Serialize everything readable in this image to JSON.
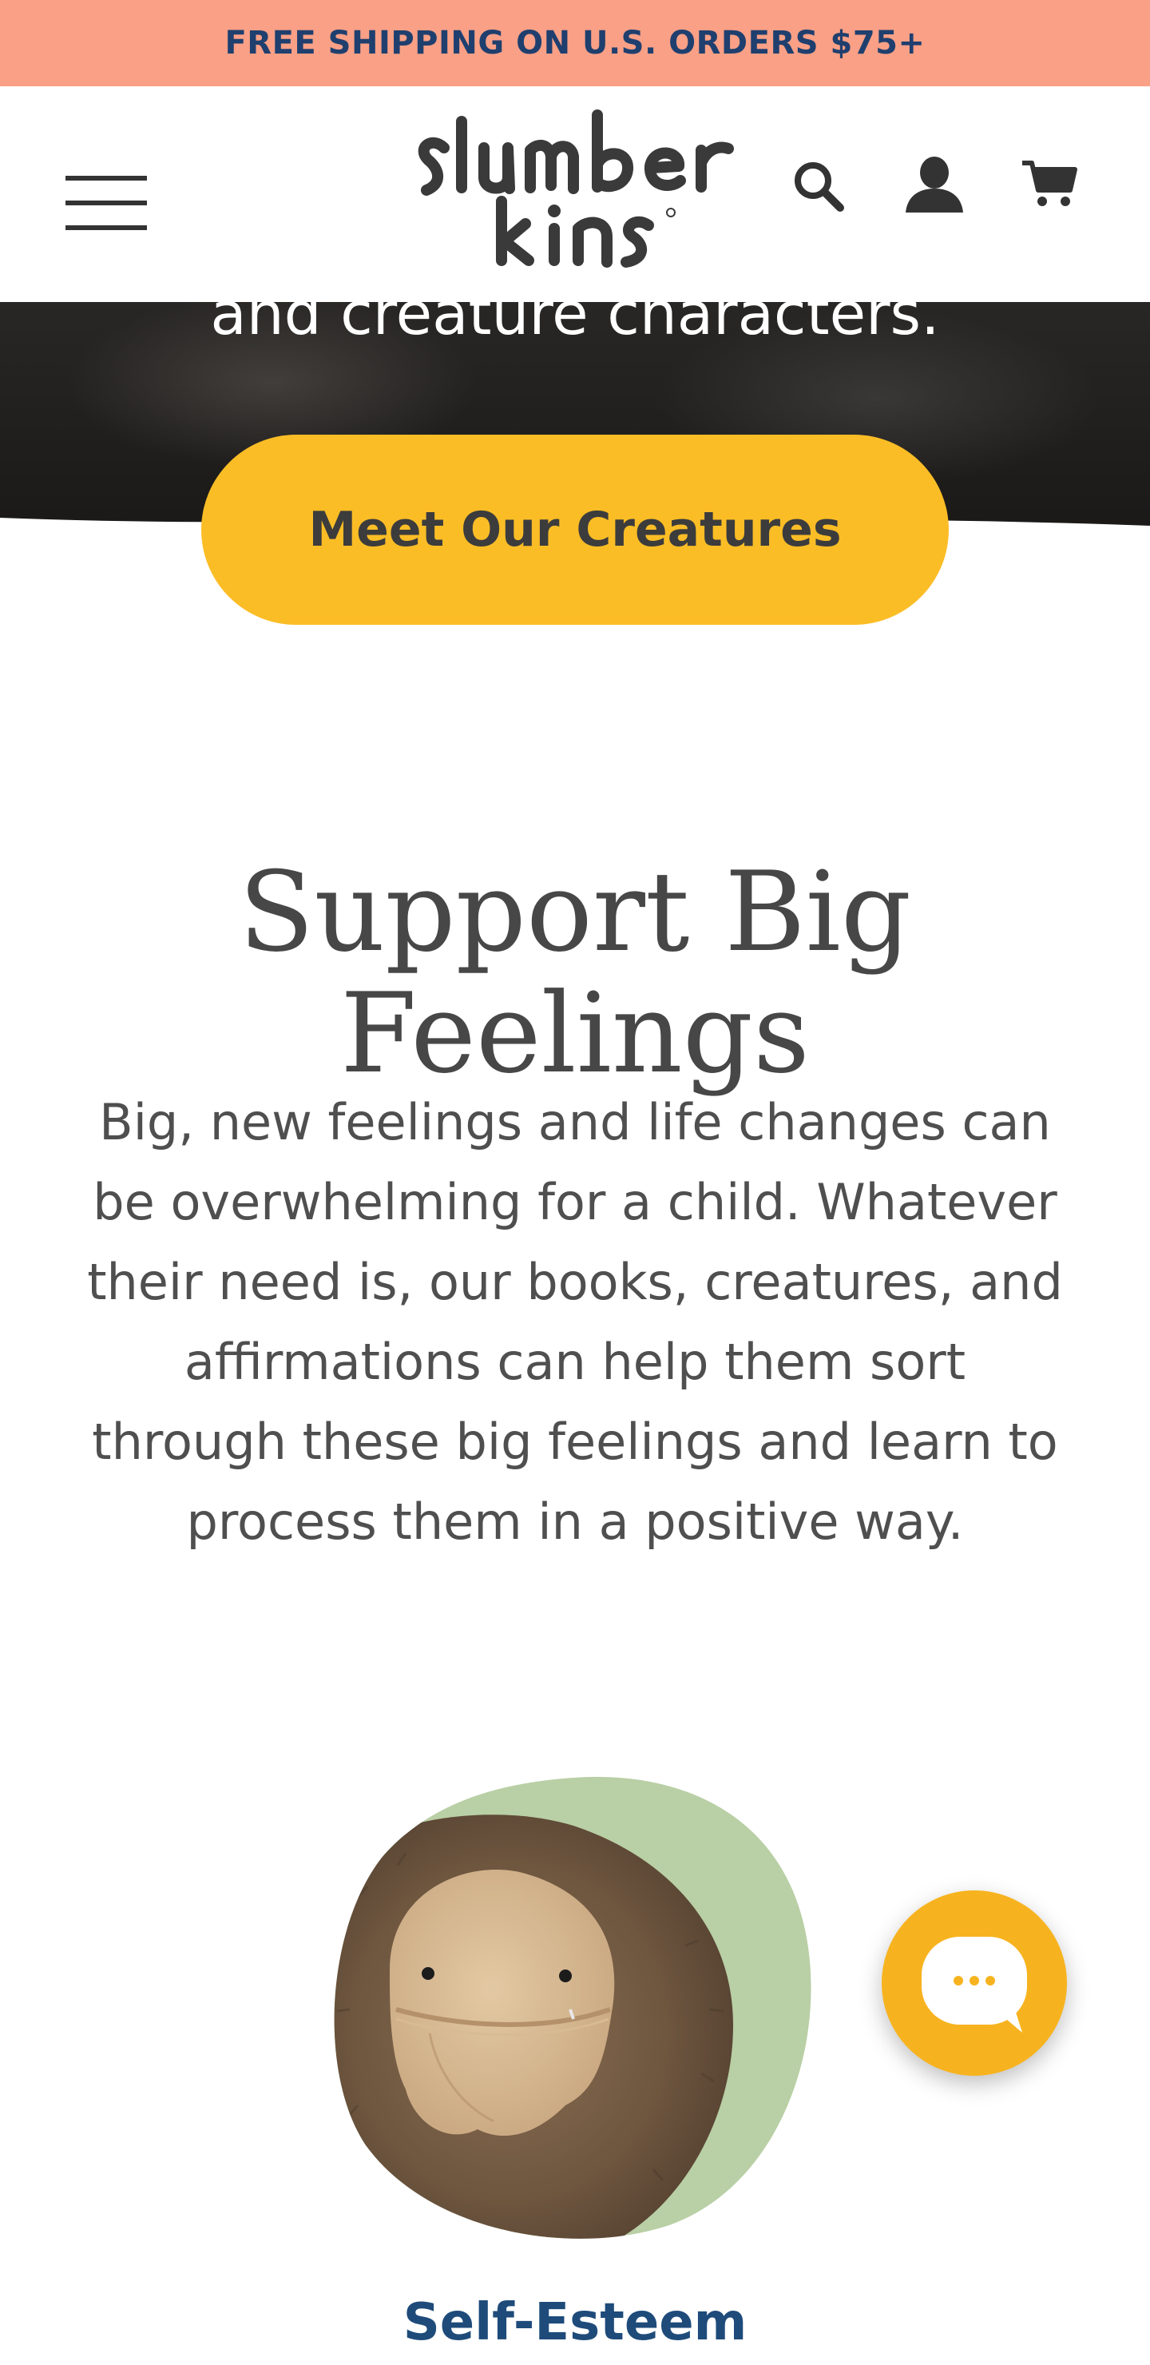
{
  "announcement": {
    "text": "FREE SHIPPING ON U.S. ORDERS $75+"
  },
  "header": {
    "logo_text": "slumberkins",
    "icons": [
      "menu-icon",
      "search-icon",
      "account-icon",
      "cart-icon"
    ]
  },
  "hero": {
    "text_line": "and creature characters.",
    "cta_label": "Meet Our Creatures"
  },
  "section": {
    "title": "Support Big Feelings",
    "body_lines": [
      "Big, new feelings and life changes can",
      "be overwhelming for a child. Whatever",
      "their need is, our books, creatures, and",
      "affirmations can help them sort",
      "through these big feelings and learn to",
      "process them in a positive way."
    ]
  },
  "category": {
    "label": "Self-Esteem"
  },
  "chat": {
    "icon": "chat-bubble-icon"
  },
  "colors": {
    "announcement_bg": "#f9a086",
    "announcement_text": "#1f3f6e",
    "cta_bg": "#fbbd26",
    "category_label": "#1e4b7a",
    "chat_bg": "#f7b31f"
  }
}
